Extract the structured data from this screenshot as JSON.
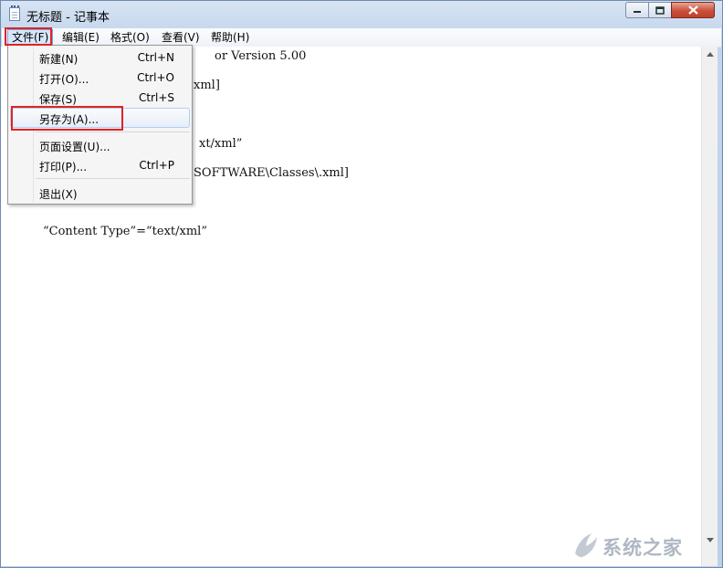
{
  "window": {
    "title": "无标题 - 记事本",
    "icon": "notepad-icon",
    "controls": {
      "minimize": "minimize-icon",
      "maximize": "maximize-icon",
      "close": "close-icon"
    }
  },
  "menubar": {
    "items": [
      {
        "label": "文件(F)",
        "active": true
      },
      {
        "label": "编辑(E)"
      },
      {
        "label": "格式(O)"
      },
      {
        "label": "查看(V)"
      },
      {
        "label": "帮助(H)"
      }
    ]
  },
  "file_menu": {
    "items": [
      {
        "label": "新建(N)",
        "shortcut": "Ctrl+N"
      },
      {
        "label": "打开(O)...",
        "shortcut": "Ctrl+O"
      },
      {
        "label": "保存(S)",
        "shortcut": "Ctrl+S"
      },
      {
        "label": "另存为(A)...",
        "shortcut": "",
        "hovered": true
      },
      {
        "label": "页面设置(U)...",
        "shortcut": ""
      },
      {
        "label": "打印(P)...",
        "shortcut": "Ctrl+P"
      },
      {
        "label": "退出(X)",
        "shortcut": ""
      }
    ]
  },
  "editor": {
    "lines": [
      "or Version 5.00",
      "xml]",
      "xt/xml”",
      "SOFTWARE\\Classes\\.xml]",
      "“Content Type”=“text/xml”"
    ]
  },
  "watermark": {
    "text": "系统之家"
  },
  "colors": {
    "highlight_box": "#e02323",
    "menu_active": "#d6e6fa",
    "close_button": "#c9503b"
  }
}
